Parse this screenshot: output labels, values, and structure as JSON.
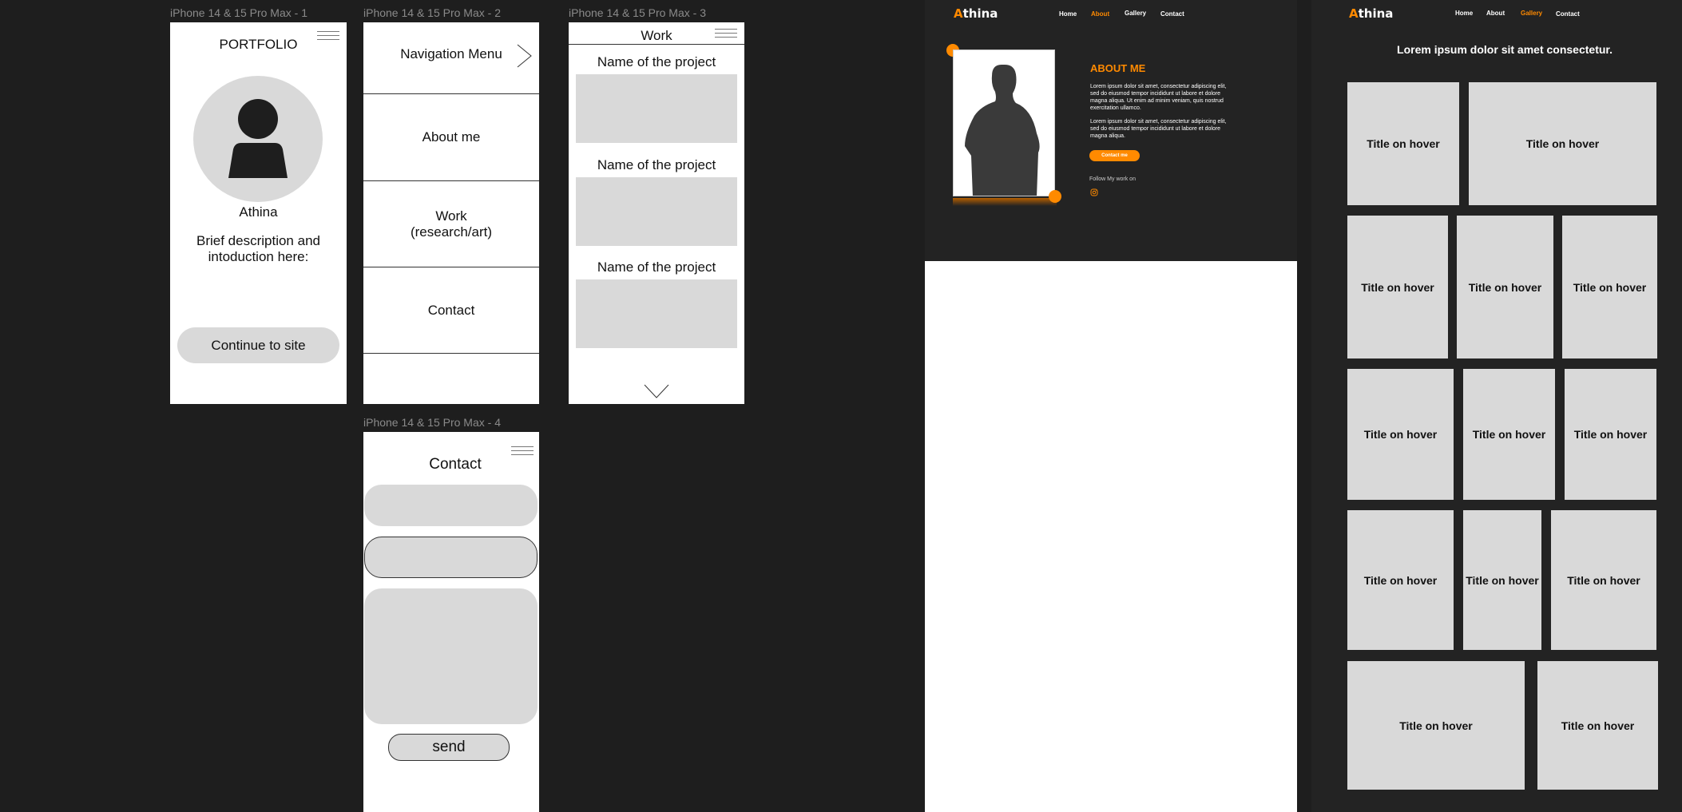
{
  "frames": {
    "f1": {
      "label": "iPhone 14 & 15 Pro Max - 1",
      "title": "PORTFOLIO",
      "name": "Athina",
      "description_line1": "Brief description and",
      "description_line2": "intoduction here:",
      "button": "Continue to site"
    },
    "f2": {
      "label": "iPhone 14 & 15 Pro Max - 2",
      "heading": "Navigation Menu",
      "items": [
        "About me",
        "Work",
        "(research/art)",
        "Contact"
      ]
    },
    "f3": {
      "label": "iPhone 14 & 15 Pro Max - 3",
      "title": "Work",
      "projects": [
        "Name of the project",
        "Name of the project",
        "Name of the project"
      ]
    },
    "f4": {
      "label": "iPhone 14 & 15 Pro Max - 4",
      "title": "Contact",
      "button": "send"
    }
  },
  "about_page": {
    "logo_accent": "A",
    "logo_rest": "thina",
    "nav": [
      "Home",
      "About",
      "Gallery",
      "Contact"
    ],
    "active_nav": "About",
    "heading": "ABOUT ME",
    "para1_lines": [
      "Lorem ipsum dolor sit amet, consectetur adipiscing elit,",
      "sed do eiusmod tempor incididunt ut labore et dolore",
      "magna aliqua. Ut enim ad minim veniam, quis nostrud",
      "exercitation ullamco."
    ],
    "para2_lines": [
      "Lorem ipsum dolor sit amet, consectetur adipiscing elit,",
      "sed do eiusmod tempor incididunt ut labore et dolore",
      "magna aliqua."
    ],
    "contact_button": "Contact me",
    "follow_text": "Follow My work on"
  },
  "gallery_page": {
    "logo_accent": "A",
    "logo_rest": "thina",
    "nav": [
      "Home",
      "About",
      "Gallery",
      "Contact"
    ],
    "active_nav": "Gallery",
    "heading": "Lorem ipsum dolor sit amet consectetur.",
    "tile_label": "Title on hover"
  },
  "colors": {
    "accent": "#ff8a00",
    "canvas": "#1e1e1e",
    "dark_page": "#232323",
    "placeholder": "#d9d9d9"
  }
}
